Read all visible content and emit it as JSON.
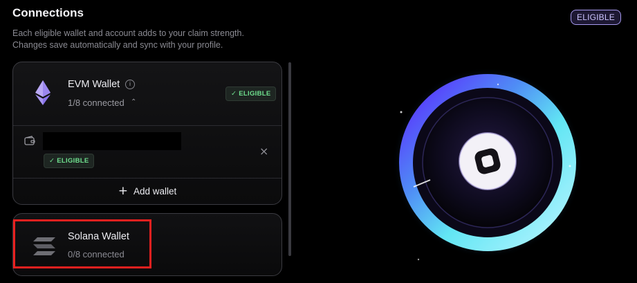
{
  "header": {
    "title": "Connections",
    "description_line1": "Each eligible wallet and account adds to your claim strength.",
    "description_line2": "Changes save automatically and sync with your profile.",
    "status_badge": "ELIGIBLE"
  },
  "evm_wallet": {
    "name": "EVM Wallet",
    "info_glyph": "i",
    "connected": "1/8 connected",
    "badge": "ELIGIBLE",
    "icon": "ethereum-icon",
    "wallets": [
      {
        "address": "",
        "badge": "ELIGIBLE",
        "icon": "wallet-icon"
      }
    ],
    "add_wallet_label": "Add wallet"
  },
  "solana_wallet": {
    "name": "Solana Wallet",
    "connected": "0/8 connected",
    "icon": "solana-icon"
  },
  "colors": {
    "accent_purple": "#a79af0",
    "eligible_green": "#6fe08e",
    "highlight_red": "#e8201f",
    "ring_cyan": "#4fe3f0",
    "ring_violet": "#6a2cff"
  }
}
